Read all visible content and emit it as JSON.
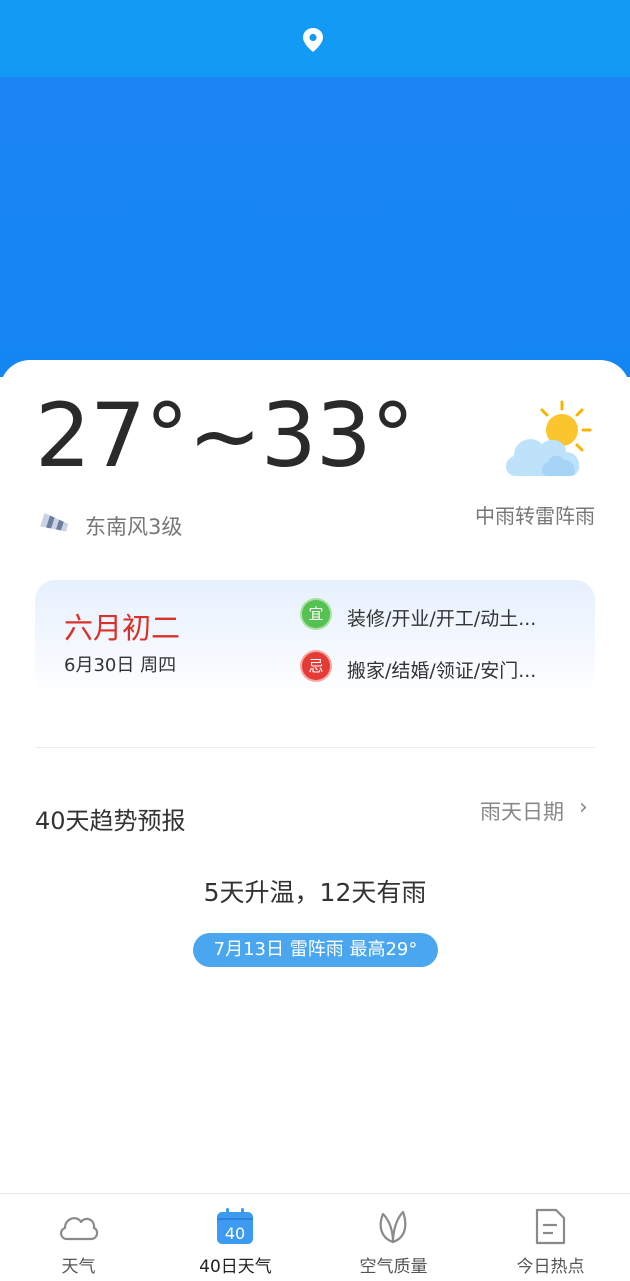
{
  "weather": {
    "temp_range": "27°~33°",
    "wind": "东南风3级",
    "description": "中雨转雷阵雨",
    "icon": "partly-cloudy-sun-icon"
  },
  "almanac": {
    "lunar_date": "六月初二",
    "solar_date": "6月30日 周四",
    "yi_badge": "宜",
    "yi_text": "装修/开业/开工/动土...",
    "ji_badge": "忌",
    "ji_text": "搬家/结婚/领证/安门..."
  },
  "trend": {
    "title": "40天趋势预报",
    "rain_days_link": "雨天日期",
    "chevron": "›",
    "summary": "5天升温，12天有雨",
    "highlight": "7月13日 雷阵雨 最高29°"
  },
  "nav": {
    "items": [
      {
        "label": "天气",
        "icon": "cloud-icon"
      },
      {
        "label": "40日天气",
        "icon": "calendar-40-icon",
        "badge": "40"
      },
      {
        "label": "空气质量",
        "icon": "leaf-icon"
      },
      {
        "label": "今日热点",
        "icon": "document-icon"
      }
    ]
  },
  "colors": {
    "top_bar": "#139af4",
    "hero": "#1486f2",
    "lunar_red": "#d9312b",
    "pill": "#4aa6ef"
  }
}
